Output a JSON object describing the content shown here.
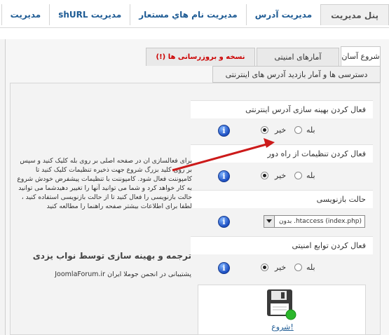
{
  "nav": {
    "tabs": [
      {
        "label": "پنل مدیریت",
        "active": true
      },
      {
        "label": "مدیریت آدرس"
      },
      {
        "label": "مدیریت نام هاي مستعار"
      },
      {
        "label": "shURL مدیریت"
      },
      {
        "label": "مدیریت"
      }
    ]
  },
  "content_tabs": {
    "quick_start": "شروع آسان",
    "security_stats": "آمارهای امنیتی",
    "backup_update": "(!) نسخه و بروزرسانی ها",
    "visit_stats": "دسترسی ها و آمار بازدید آدرس های اینترنتی"
  },
  "settings": {
    "enable_seo": {
      "label": "فعال کردن بهینه سازی آدرس اینترنتی",
      "yes": "بله",
      "no": "خیر",
      "selected": "no"
    },
    "enable_remote": {
      "label": "فعال کردن تنظیمات از راه دور",
      "yes": "بله",
      "no": "خیر",
      "selected": "no"
    },
    "rewrite_mode": {
      "label": "حالت بازنویسی",
      "value": "بدون .htaccess (index.php)"
    },
    "enable_security": {
      "label": "فعال کردن توابع امنیتی",
      "yes": "بله",
      "no": "خیر",
      "selected": "no"
    }
  },
  "description": "برای فعالسازی ان در صفحه اصلی بر روی بله کلیک کنید و سپس بر روی کلید بزرگ شروع جهت ذخیره تنظیمات کلیک کنید تا کامپوننت فعال شود. کامپوننت با تنظیمات پیشفرض خودش شروع به کار خواهد کرد و شما می توانید آنها را تغییر دهیدشما می توانید حالت بازنویسی را فعال کنید تا از حالت بازنویسی استفاده کنید ، لطفا برای اطلاعات بیشتر صفحه راهنما را مطالعه کنید",
  "translator": "ترجمه و بهینه سازی توسط نواب یزدی",
  "support": "پشتیبانی در انجمن جوملا ایران JoomlaForum.ir",
  "start_button": {
    "label": "شروع!"
  },
  "icons": {
    "info": "info-icon",
    "save": "floppy-disk-icon",
    "arrow": "red-arrow"
  },
  "colors": {
    "link": "#1e5b94",
    "alert_red": "#cc0000",
    "arrow": "#cc1a1a",
    "info_blue": "#1d4fc2"
  }
}
